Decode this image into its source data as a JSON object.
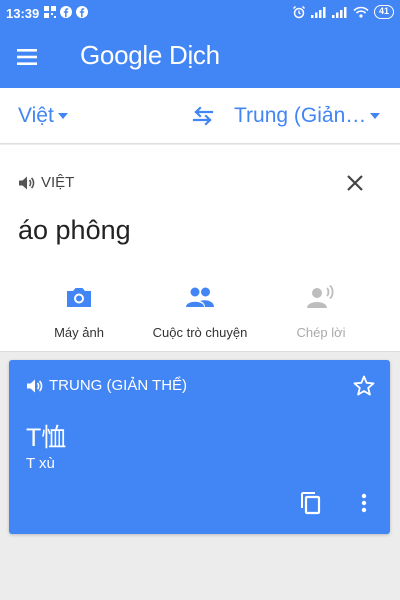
{
  "status_bar": {
    "time": "13:39",
    "battery": "41"
  },
  "app_bar": {
    "title": "Google Dịch"
  },
  "languages": {
    "source": "Việt",
    "target": "Trung (Giản…"
  },
  "input": {
    "language_label": "VIỆT",
    "text": "áo phông"
  },
  "tools": [
    {
      "label": "Máy ảnh",
      "icon": "camera-icon",
      "enabled": true
    },
    {
      "label": "Cuộc trò chuyện",
      "icon": "conversation-icon",
      "enabled": true
    },
    {
      "label": "Chép lời",
      "icon": "transcribe-icon",
      "enabled": false
    }
  ],
  "result": {
    "language_label": "TRUNG (GIẢN THỂ)",
    "text": "T恤",
    "romanization": "T xù"
  },
  "colors": {
    "primary": "#4285f4",
    "disabled": "#aaaaaa"
  }
}
